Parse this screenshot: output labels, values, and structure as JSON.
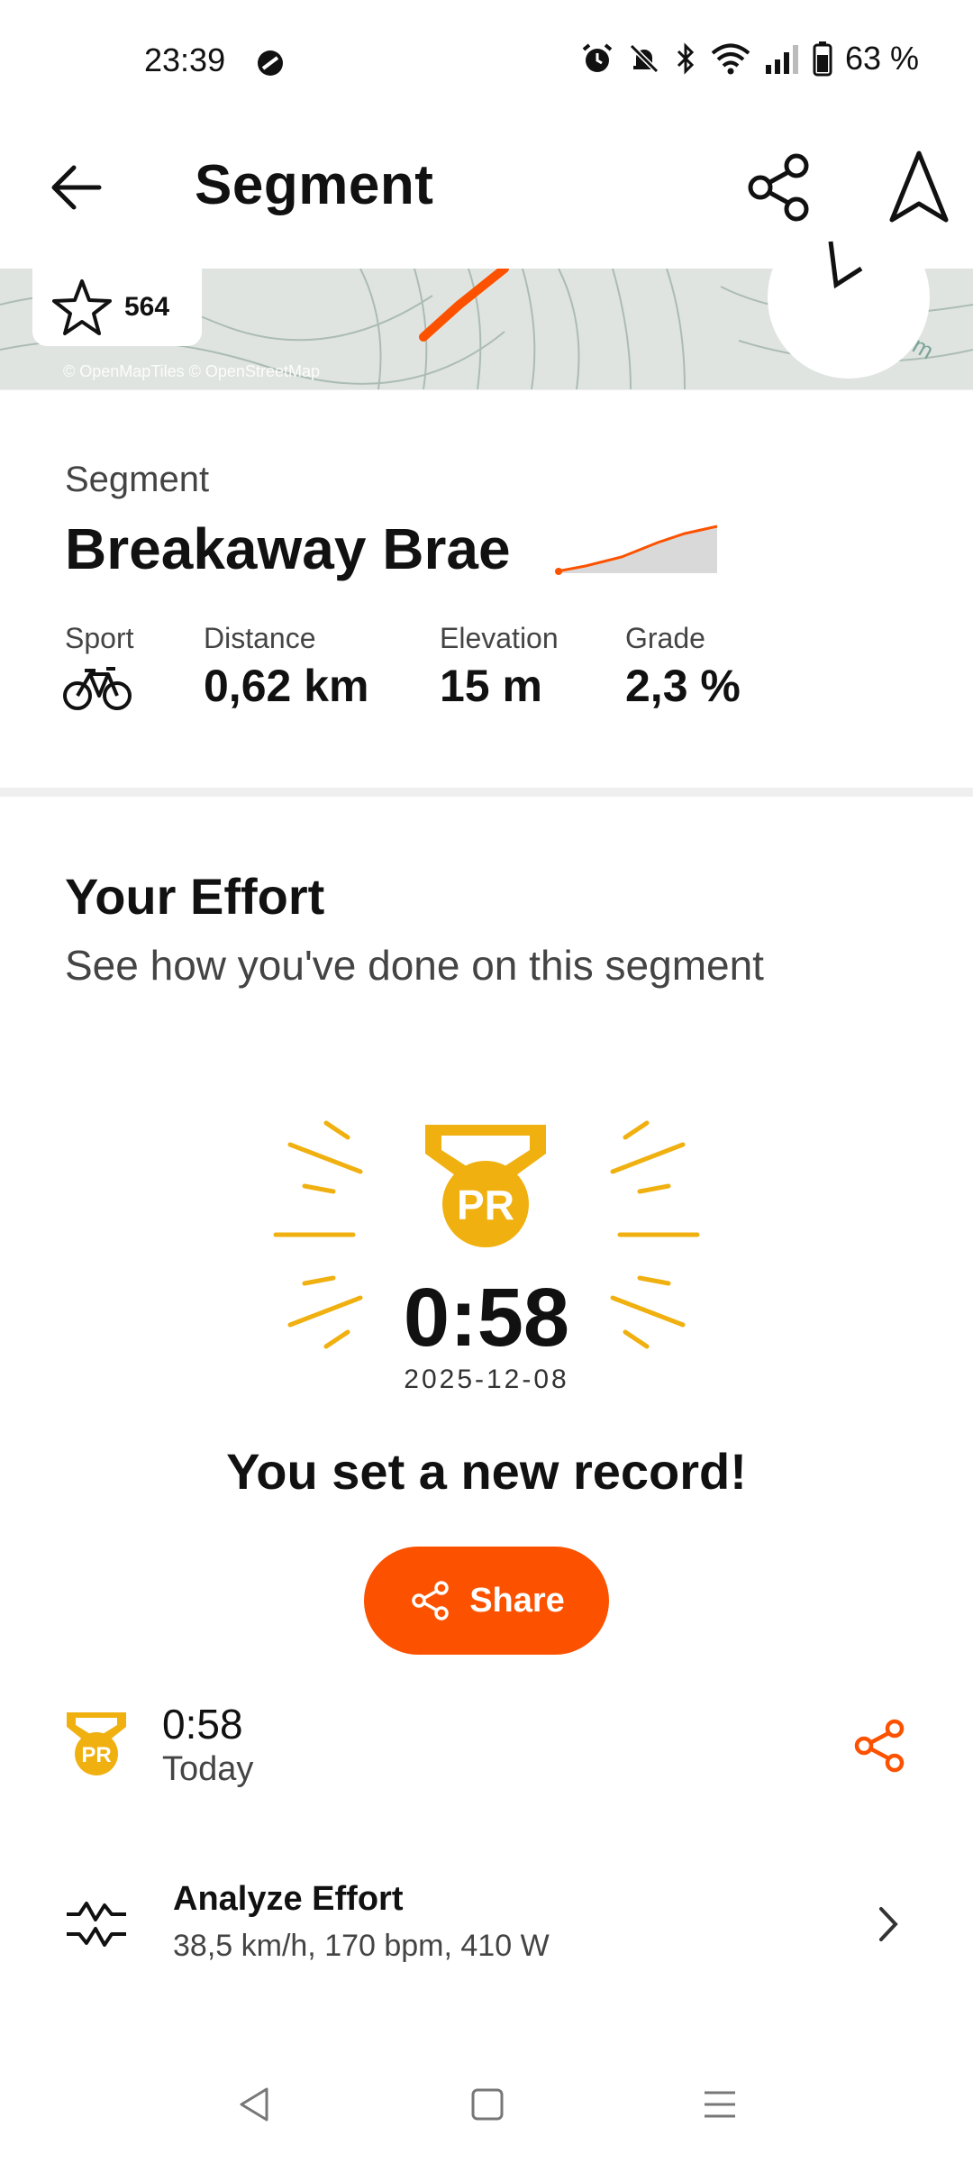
{
  "status_bar": {
    "time": "23:39",
    "battery": "63 %",
    "icons": [
      "dnd-badge-icon",
      "alarm-icon",
      "bell-off-icon",
      "bluetooth-icon",
      "wifi-icon",
      "signal-icon",
      "battery-icon"
    ]
  },
  "header": {
    "title": "Segment",
    "icons": [
      "back-arrow-icon",
      "share-icon",
      "navigate-icon"
    ]
  },
  "map": {
    "star_count": "564",
    "credit": "© OpenMapTiles © OpenStreetMap",
    "scale_label": "00 m",
    "route_color": "#fc5200"
  },
  "segment": {
    "label": "Segment",
    "name": "Breakaway Brae",
    "stats": [
      {
        "label": "Sport",
        "icon": "bike-icon"
      },
      {
        "label": "Distance",
        "value": "0,62 km"
      },
      {
        "label": "Elevation",
        "value": "15 m"
      },
      {
        "label": "Grade",
        "value": "2,3 %"
      }
    ]
  },
  "effort": {
    "title": "Your Effort",
    "subtitle": "See how you've done on this segment",
    "medal_text": "PR",
    "pr_time": "0:58",
    "pr_date": "2025-12-08",
    "record_text": "You set a new record!",
    "share_label": "Share"
  },
  "effort_row": {
    "medal_text": "PR",
    "time": "0:58",
    "date": "Today"
  },
  "analyze": {
    "title": "Analyze Effort",
    "subtitle": "38,5 km/h, 170 bpm, 410 W"
  },
  "colors": {
    "accent": "#fc5200",
    "gold": "#f0b010",
    "text": "#111111",
    "muted": "#444444"
  }
}
